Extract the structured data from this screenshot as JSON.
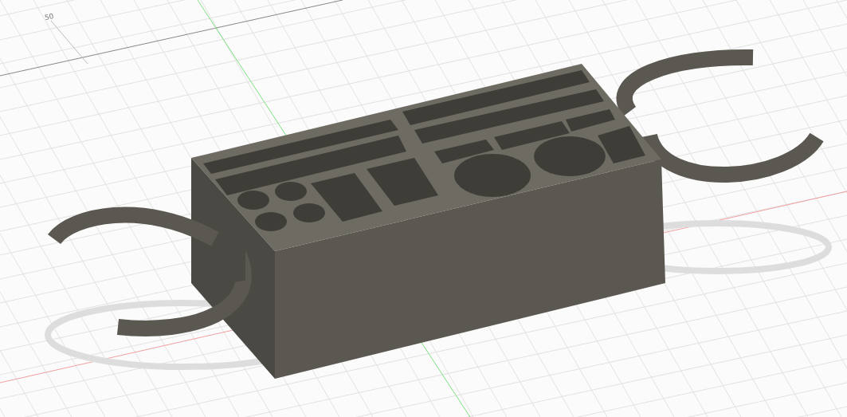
{
  "viewport": {
    "grid_label": "50"
  }
}
